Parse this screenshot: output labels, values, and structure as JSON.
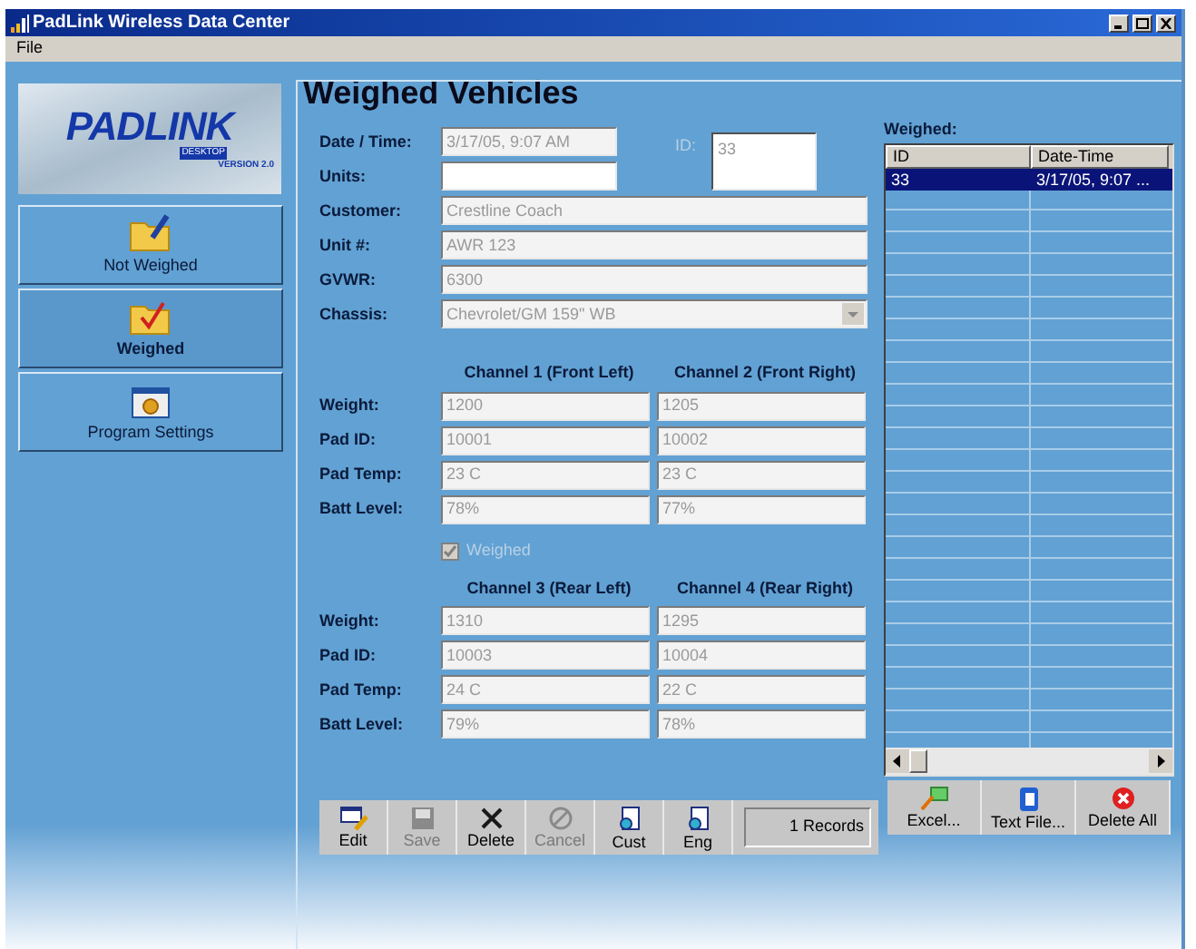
{
  "window": {
    "title": "PadLink Wireless Data Center"
  },
  "menu": [
    "File"
  ],
  "sidebar": {
    "logo": {
      "name": "PADLINK",
      "subtitle": "DESKTOP",
      "version": "VERSION 2.0"
    },
    "items": [
      {
        "label": "Not Weighed",
        "selected": false
      },
      {
        "label": "Weighed",
        "selected": true
      },
      {
        "label": "Program Settings",
        "selected": false
      }
    ]
  },
  "panel": {
    "title": "Weighed Vehicles",
    "fields": [
      {
        "kind": "text",
        "label": "Date / Time:",
        "value": "3/17/05, 9:07 AM",
        "disabled": true
      },
      {
        "kind": "text",
        "label": "Units:",
        "disabled": false
      },
      {
        "kind": "text",
        "label": "Customer:",
        "value": "Crestline Coach",
        "disabled": true
      },
      {
        "kind": "text",
        "label": "Unit #:",
        "value": "AWR 123",
        "disabled": true
      },
      {
        "kind": "text",
        "label": "GVWR:",
        "value": "6300",
        "disabled": true
      },
      {
        "kind": "select",
        "label": "Chassis:",
        "value": "Chevrolet/GM 159\" WB",
        "disabled": true
      }
    ],
    "id_field": {
      "label": "ID:",
      "value": "33"
    },
    "channel_groups": [
      {
        "headers": [
          "Channel 1 (Front Left)",
          "Channel 2 (Front Right)"
        ],
        "rows": [
          {
            "label": "Weight:",
            "values": [
              "1200",
              "1205"
            ]
          },
          {
            "label": "Pad ID:",
            "values": [
              "10001",
              "10002"
            ]
          },
          {
            "label": "Pad Temp:",
            "values": [
              "23 C",
              "23 C"
            ]
          },
          {
            "label": "Batt Level:",
            "values": [
              "78%",
              "77%"
            ]
          }
        ]
      },
      {
        "headers": [
          "Channel 3 (Rear Left)",
          "Channel 4 (Rear Right)"
        ],
        "rows": [
          {
            "label": "Weight:",
            "values": [
              "1310",
              "1295"
            ]
          },
          {
            "label": "Pad ID:",
            "values": [
              "10003",
              "10004"
            ]
          },
          {
            "label": "Pad Temp:",
            "values": [
              "24 C",
              "22 C"
            ]
          },
          {
            "label": "Batt Level:",
            "values": [
              "79%",
              "78%"
            ]
          }
        ]
      }
    ],
    "weighed_checkbox": {
      "label": "Weighed",
      "checked": true,
      "disabled": true
    },
    "toolbar": [
      {
        "label": "Edit",
        "disabled": false
      },
      {
        "label": "Save",
        "disabled": true
      },
      {
        "label": "Delete",
        "disabled": false
      },
      {
        "label": "Cancel",
        "disabled": true
      },
      {
        "label": "Cust",
        "disabled": false
      },
      {
        "label": "Eng",
        "disabled": false
      }
    ],
    "record_count": "1 Records"
  },
  "list": {
    "heading": "Weighed:",
    "columns": [
      "ID",
      "Date-Time"
    ],
    "rows": [
      {
        "cells": [
          "33",
          "3/17/05, 9:07 ..."
        ],
        "selected": true
      }
    ],
    "buttons": [
      {
        "label": "Excel..."
      },
      {
        "label": "Text File..."
      },
      {
        "label": "Delete All"
      }
    ]
  }
}
